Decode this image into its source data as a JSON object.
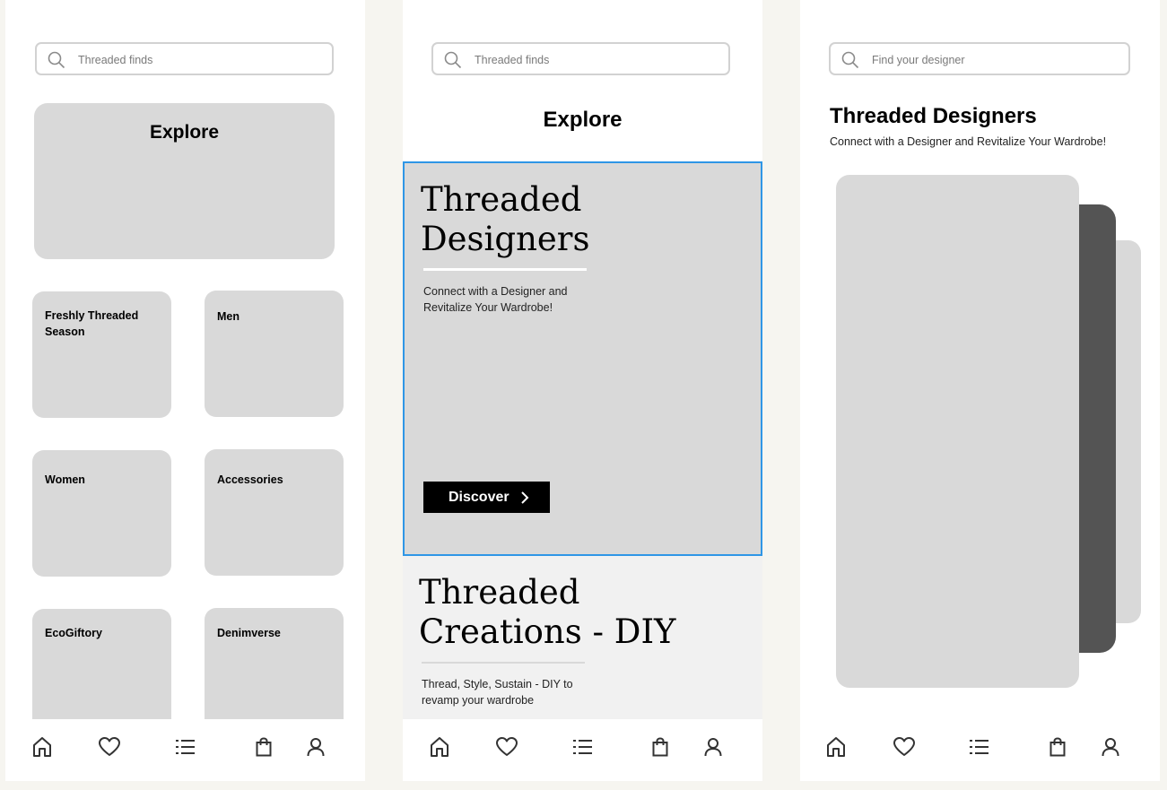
{
  "screen1": {
    "search_placeholder": "Threaded finds",
    "hero_title": "Explore",
    "categories": [
      {
        "label": "Freshly Threaded Season"
      },
      {
        "label": "Men"
      },
      {
        "label": "Women"
      },
      {
        "label": "Accessories"
      },
      {
        "label": "EcoGiftory"
      },
      {
        "label": "Denimverse"
      }
    ]
  },
  "screen2": {
    "search_placeholder": "Threaded finds",
    "title": "Explore",
    "feature1": {
      "heading_line1": "Threaded",
      "heading_line2": "Designers",
      "sub_line1": "Connect with a Designer and",
      "sub_line2": "Revitalize Your Wardrobe!",
      "button_label": "Discover"
    },
    "feature2": {
      "heading_line1": "Threaded",
      "heading_line2": "Creations - DIY",
      "sub_line1": "Thread, Style, Sustain - DIY to",
      "sub_line2": "revamp your wardrobe"
    }
  },
  "screen3": {
    "search_placeholder": "Find your designer",
    "title": "Threaded Designers",
    "subtitle": "Connect with a Designer and Revitalize Your Wardrobe!"
  },
  "nav": {
    "icons": [
      "home-icon",
      "heart-icon",
      "list-icon",
      "shopping-bag-icon",
      "user-icon"
    ]
  },
  "colors": {
    "placeholder_gray": "#d9d9d9",
    "selection_blue": "#2f96e6",
    "card_dark": "#545454",
    "page_bg": "#f6f5f0"
  }
}
